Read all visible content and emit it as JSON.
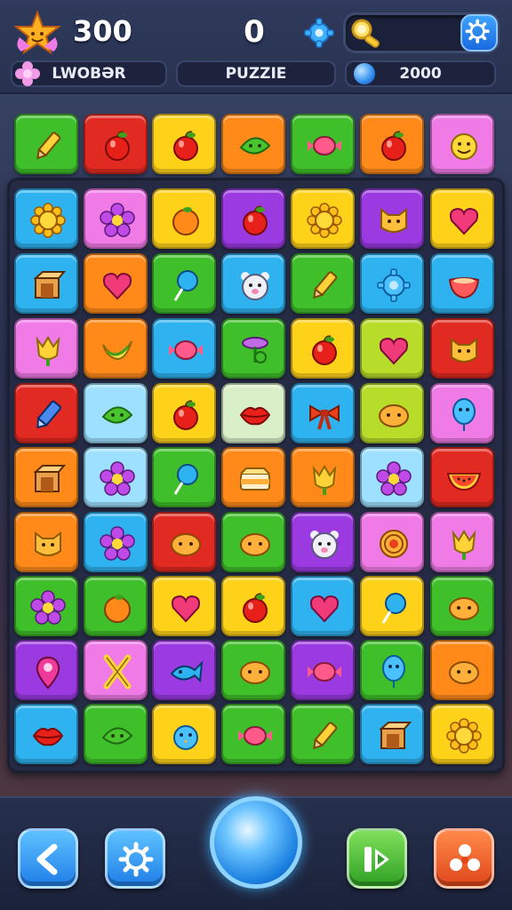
{
  "hud": {
    "score": "300",
    "moves": "0",
    "player_label": "LWOBƏR",
    "mode_label": "PUZZIE",
    "coins": "2000"
  },
  "colors": {
    "green": "#3fc02a",
    "red": "#e02a22",
    "yellow": "#ffd21a",
    "orange": "#ff8a1a",
    "pink": "#f07ae6",
    "blue": "#2fb2f0",
    "purple": "#9a3ae0",
    "lime": "#b8dc2a",
    "sky": "#9ee0ff",
    "mint": "#d8efc8"
  },
  "top_row": [
    {
      "color": "green",
      "icon": "pencil-icon"
    },
    {
      "color": "red",
      "icon": "apple-icon"
    },
    {
      "color": "yellow",
      "icon": "apple-icon"
    },
    {
      "color": "orange",
      "icon": "leaf-icon"
    },
    {
      "color": "green",
      "icon": "candy-icon"
    },
    {
      "color": "orange",
      "icon": "apple-icon"
    },
    {
      "color": "pink",
      "icon": "smiley-icon"
    }
  ],
  "grid": [
    [
      {
        "color": "blue",
        "icon": "sun-icon"
      },
      {
        "color": "pink",
        "icon": "flower-icon"
      },
      {
        "color": "yellow",
        "icon": "orange-icon"
      },
      {
        "color": "purple",
        "icon": "apple-icon"
      },
      {
        "color": "yellow",
        "icon": "sun-icon"
      },
      {
        "color": "purple",
        "icon": "cat-icon"
      },
      {
        "color": "yellow",
        "icon": "heart-icon"
      }
    ],
    [
      {
        "color": "blue",
        "icon": "box-icon"
      },
      {
        "color": "orange",
        "icon": "heart-icon"
      },
      {
        "color": "green",
        "icon": "lollipop-icon"
      },
      {
        "color": "blue",
        "icon": "bear-icon"
      },
      {
        "color": "green",
        "icon": "pencil-icon"
      },
      {
        "color": "blue",
        "icon": "gear-icon"
      },
      {
        "color": "blue",
        "icon": "bowl-icon"
      }
    ],
    [
      {
        "color": "pink",
        "icon": "tulip-icon"
      },
      {
        "color": "orange",
        "icon": "banana-icon"
      },
      {
        "color": "blue",
        "icon": "candy-icon"
      },
      {
        "color": "green",
        "icon": "plant-icon"
      },
      {
        "color": "yellow",
        "icon": "apple-icon"
      },
      {
        "color": "lime",
        "icon": "heart-icon"
      },
      {
        "color": "red",
        "icon": "cat-icon"
      }
    ],
    [
      {
        "color": "red",
        "icon": "crayon-icon"
      },
      {
        "color": "sky",
        "icon": "leaf-icon"
      },
      {
        "color": "yellow",
        "icon": "apple-icon"
      },
      {
        "color": "mint",
        "icon": "lips-icon"
      },
      {
        "color": "blue",
        "icon": "bow-icon"
      },
      {
        "color": "lime",
        "icon": "blob-icon"
      },
      {
        "color": "pink",
        "icon": "balloon-icon"
      }
    ],
    [
      {
        "color": "orange",
        "icon": "box-icon"
      },
      {
        "color": "sky",
        "icon": "flower-icon"
      },
      {
        "color": "green",
        "icon": "lollipop-icon"
      },
      {
        "color": "orange",
        "icon": "cake-icon"
      },
      {
        "color": "orange",
        "icon": "tulip-icon"
      },
      {
        "color": "sky",
        "icon": "flower-icon"
      },
      {
        "color": "red",
        "icon": "melon-icon"
      }
    ],
    [
      {
        "color": "orange",
        "icon": "cat-icon"
      },
      {
        "color": "blue",
        "icon": "flower-icon"
      },
      {
        "color": "red",
        "icon": "blob-icon"
      },
      {
        "color": "green",
        "icon": "blob-icon"
      },
      {
        "color": "purple",
        "icon": "bear-icon"
      },
      {
        "color": "pink",
        "icon": "target-icon"
      },
      {
        "color": "pink",
        "icon": "tulip-icon"
      }
    ],
    [
      {
        "color": "green",
        "icon": "flower-icon"
      },
      {
        "color": "green",
        "icon": "orange-icon"
      },
      {
        "color": "yellow",
        "icon": "heart-icon"
      },
      {
        "color": "yellow",
        "icon": "apple-icon"
      },
      {
        "color": "blue",
        "icon": "heart-icon"
      },
      {
        "color": "yellow",
        "icon": "lollipop-icon"
      },
      {
        "color": "green",
        "icon": "blob-icon"
      }
    ],
    [
      {
        "color": "purple",
        "icon": "pin-icon"
      },
      {
        "color": "pink",
        "icon": "cross-icon"
      },
      {
        "color": "purple",
        "icon": "fish-icon"
      },
      {
        "color": "green",
        "icon": "blob-icon"
      },
      {
        "color": "purple",
        "icon": "candy-icon"
      },
      {
        "color": "green",
        "icon": "balloon-icon"
      },
      {
        "color": "orange",
        "icon": "blob-icon"
      }
    ],
    [
      {
        "color": "blue",
        "icon": "lips-icon"
      },
      {
        "color": "green",
        "icon": "leaf-icon"
      },
      {
        "color": "yellow",
        "icon": "bird-icon"
      },
      {
        "color": "green",
        "icon": "candy-icon"
      },
      {
        "color": "green",
        "icon": "pencil-icon"
      },
      {
        "color": "blue",
        "icon": "box-icon"
      },
      {
        "color": "yellow",
        "icon": "sun-icon"
      }
    ]
  ],
  "bottom_bar": {
    "back": "back-arrow-icon",
    "settings": "gear-icon",
    "center": "orb-button",
    "next": "next-icon",
    "shuffle": "shuffle-icon"
  }
}
